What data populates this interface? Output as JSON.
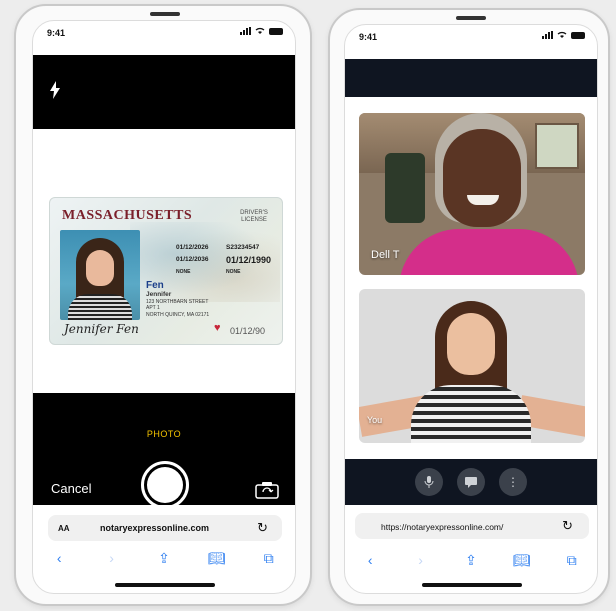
{
  "phone1": {
    "status_time": "9:41",
    "camera": {
      "mode_label": "PHOTO",
      "cancel_label": "Cancel"
    },
    "id_card": {
      "state": "MASSACHUSETTS",
      "type_line1": "DRIVER'S",
      "type_line2": "LICENSE",
      "date1": "01/12/2026",
      "date2": "01/12/2036",
      "number": "S23234547",
      "dob": "01/12/1990",
      "none1": "NONE",
      "none2": "NONE",
      "surname": "Fen",
      "given_name": "Jennifer",
      "addr1": "123 NORTHBARN STREET",
      "addr2": "APT 1",
      "addr3": "NORTH QUINCY, MA 02171",
      "signature": "Jennifer Fen",
      "exp_small": "01/12/90"
    },
    "browser": {
      "aa_label": "AA",
      "url": "notaryexpressonline.com"
    }
  },
  "phone2": {
    "status_time": "9:41",
    "call": {
      "remote_name": "Dell T",
      "local_name": "You"
    },
    "browser": {
      "url": "https://notaryexpressonline.com/"
    }
  },
  "icons": {
    "flash": "flash-icon",
    "switch_camera": "switch-camera-icon",
    "reload": "reload-icon",
    "back": "back-icon",
    "forward": "forward-icon",
    "share": "share-icon",
    "bookmarks": "bookmarks-icon",
    "tabs": "tabs-icon",
    "mic": "mic-icon",
    "chat": "chat-icon",
    "more": "more-icon"
  },
  "colors": {
    "ios_blue": "#2f7ff0",
    "photo_yellow": "#f5c400",
    "call_bar": "#0f1521",
    "state_red": "#7a1f2a"
  }
}
